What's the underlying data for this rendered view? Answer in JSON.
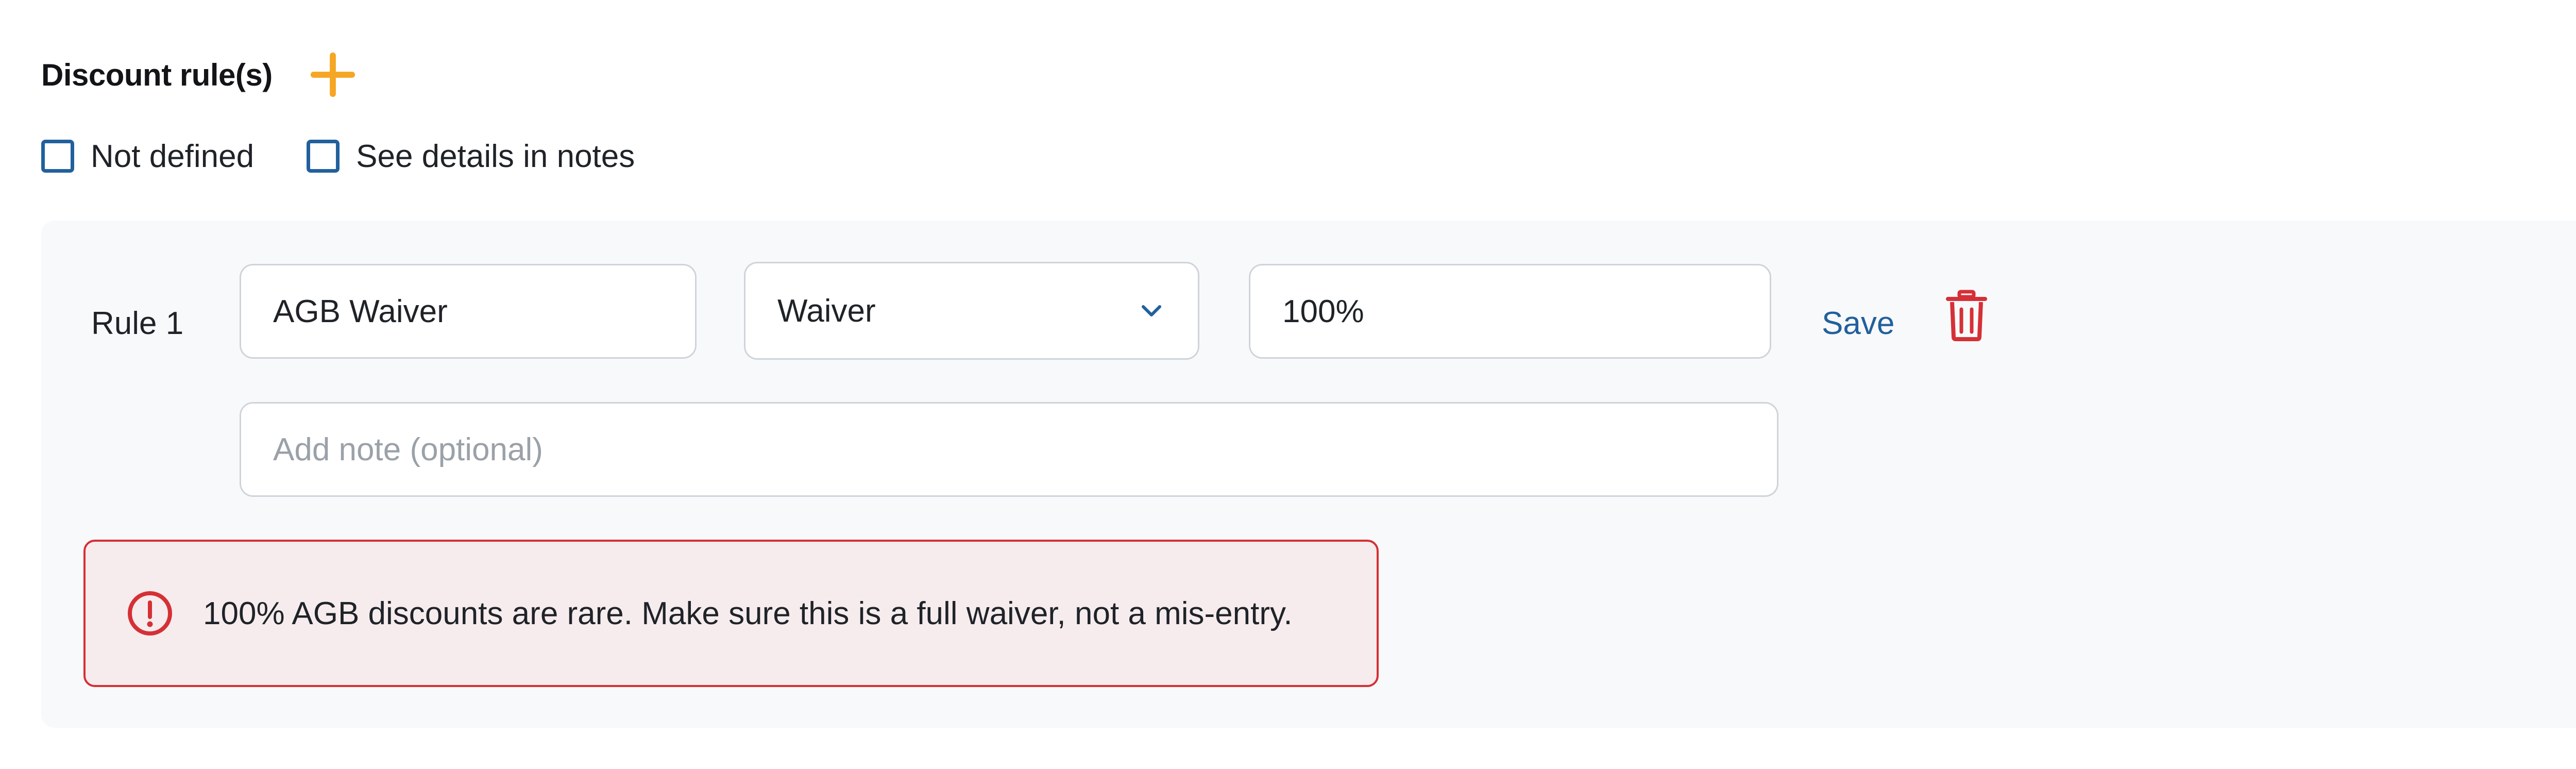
{
  "header": {
    "title": "Discount rule(s)",
    "add_icon": "plus-icon"
  },
  "options": [
    {
      "label": "Not defined",
      "checked": false
    },
    {
      "label": "See details in notes",
      "checked": false
    }
  ],
  "rule": {
    "label": "Rule 1",
    "name_value": "AGB Waiver",
    "type_value": "Waiver",
    "percent_value": "100%",
    "note_placeholder": "Add note (optional)",
    "note_value": "",
    "save_label": "Save",
    "delete_icon": "trash-icon"
  },
  "alert": {
    "icon": "exclamation-circle-icon",
    "text": "100% AGB discounts are rare. Make sure this is a full waiver, not a mis-entry."
  },
  "colors": {
    "accent_plus": "#f5a623",
    "checkbox_border": "#22609d",
    "link": "#22609d",
    "danger": "#d53036",
    "alert_bg": "#f6eced",
    "panel_bg": "#f8f9fa"
  }
}
